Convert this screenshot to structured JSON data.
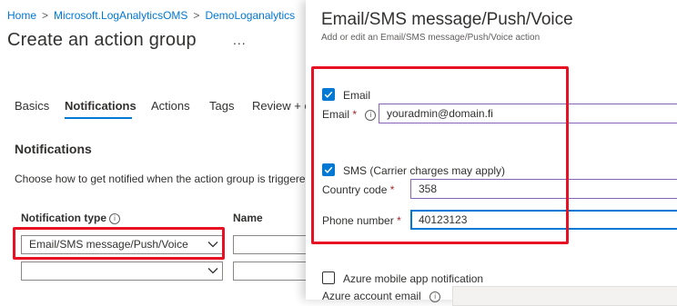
{
  "breadcrumb": {
    "items": [
      "Home",
      "Microsoft.LogAnalyticsOMS",
      "DemoLoganalytics"
    ],
    "separator": ">"
  },
  "page": {
    "title": "Create an action group",
    "more_label": "..."
  },
  "tabs": [
    {
      "label": "Basics",
      "active": false
    },
    {
      "label": "Notifications",
      "active": true
    },
    {
      "label": "Actions",
      "active": false
    },
    {
      "label": "Tags",
      "active": false
    },
    {
      "label": "Review + c",
      "active": false
    }
  ],
  "notifications": {
    "heading": "Notifications",
    "description": "Choose how to get notified when the action group is triggered",
    "columns": {
      "type_label": "Notification type",
      "name_label": "Name"
    },
    "rows": [
      {
        "type_value": "Email/SMS message/Push/Voice",
        "name_value": ""
      },
      {
        "type_value": "",
        "name_value": ""
      }
    ]
  },
  "panel": {
    "title": "Email/SMS message/Push/Voice",
    "subtitle": "Add or edit an Email/SMS message/Push/Voice action",
    "email": {
      "checkbox_label": "Email",
      "checked": true,
      "field_label": "Email",
      "required_mark": "*",
      "value": "youradmin@domain.fi"
    },
    "sms": {
      "checkbox_label": "SMS (Carrier charges may apply)",
      "checked": true,
      "country_label": "Country code",
      "country_value": "358",
      "phone_label": "Phone number",
      "phone_value": "40123123",
      "required_mark": "*"
    },
    "push": {
      "checkbox_label": "Azure mobile app notification",
      "checked": false,
      "account_label": "Azure account email"
    }
  },
  "colors": {
    "accent": "#0078d4",
    "highlight_red": "#e81123",
    "required": "#a4262c",
    "purple_border": "#8764b8"
  }
}
